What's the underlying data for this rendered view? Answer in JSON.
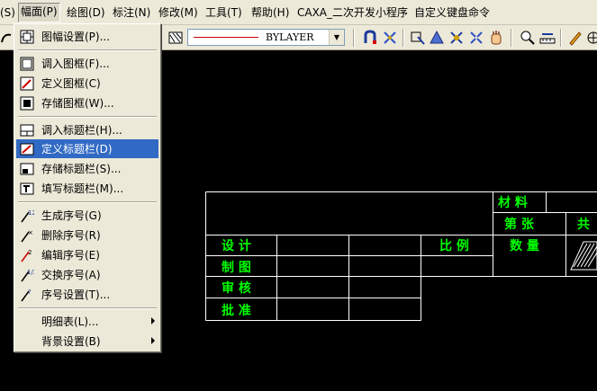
{
  "menubar": {
    "items": [
      {
        "label": "(S)"
      },
      {
        "label": "幅面(P)"
      },
      {
        "label": "绘图(D)"
      },
      {
        "label": "标注(N)"
      },
      {
        "label": "修改(M)"
      },
      {
        "label": "工具(T)"
      },
      {
        "label": "帮助(H)"
      },
      {
        "label": "CAXA_二次开发小程序"
      },
      {
        "label": "自定义键盘命令"
      }
    ]
  },
  "toolbar": {
    "linetype_value": "BYLAYER",
    "line_color": "#d00000"
  },
  "menu": {
    "items": [
      {
        "label": "图幅设置(P)...",
        "icon": "sheet-setup-icon"
      },
      {
        "label": "调入图框(F)...",
        "icon": "load-frame-icon"
      },
      {
        "label": "定义图框(C)",
        "icon": "define-frame-icon"
      },
      {
        "label": "存储图框(W)...",
        "icon": "save-frame-icon"
      },
      {
        "label": "调入标题栏(H)...",
        "icon": "load-titleblock-icon"
      },
      {
        "label": "定义标题栏(D)",
        "icon": "define-titleblock-icon",
        "selected": true
      },
      {
        "label": "存储标题栏(S)...",
        "icon": "save-titleblock-icon"
      },
      {
        "label": "填写标题栏(M)...",
        "icon": "fill-titleblock-icon"
      },
      {
        "label": "生成序号(G)",
        "icon": "generate-number-icon"
      },
      {
        "label": "删除序号(R)",
        "icon": "delete-number-icon"
      },
      {
        "label": "编辑序号(E)",
        "icon": "edit-number-icon"
      },
      {
        "label": "交换序号(A)",
        "icon": "swap-number-icon"
      },
      {
        "label": "序号设置(T)...",
        "icon": "number-settings-icon"
      },
      {
        "label": "明细表(L)...",
        "submenu": true
      },
      {
        "label": "背景设置(B)",
        "submenu": true
      }
    ]
  },
  "title_block": {
    "labels": {
      "material": "材 料",
      "sheet": "第 张",
      "total": "共",
      "design": "设 计",
      "scale": "比 例",
      "quantity": "数 量",
      "drawing": "制 图",
      "review": "审 核",
      "approve": "批 准"
    },
    "text_color": "#00ff00",
    "line_color": "#ffffff"
  }
}
